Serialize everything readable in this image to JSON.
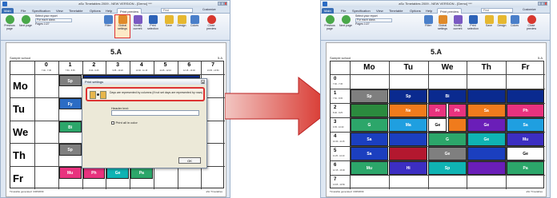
{
  "app": {
    "title": "aSc Timetables 2009 - NEW VERSION - [Demo] *** ",
    "menu_main": "Main"
  },
  "tabs": [
    "Main",
    "File",
    "Specification",
    "View",
    "Timetable",
    "Options",
    "Help",
    "Print preview"
  ],
  "find_label": "Find",
  "customize_label": "Customize",
  "ribbon": {
    "prev": "Previous page",
    "next": "Next page",
    "report_label": "Select your report",
    "report_value": "For each class",
    "pages": "Pages 1/27",
    "filter": "Filter",
    "global": "Global settings",
    "modify": "Modify current",
    "print_selection": "Print selection",
    "save": "Save",
    "design": "Design",
    "colors": "Colors",
    "close": "Close preview"
  },
  "left": {
    "school": "Sample school",
    "class": "5.A",
    "class_right": "5.A",
    "periods": [
      "0",
      "1",
      "2",
      "3",
      "4",
      "5",
      "6",
      "7"
    ],
    "period_times": [
      "7:00 - 7:45",
      "7:50 - 8:35",
      "8:40 - 9:25",
      "9:35 - 10:20",
      "10:30 - 11:15",
      "11:25 - 12:10",
      "12:15 - 13:00",
      "13:05 - 13:50"
    ],
    "days": [
      "Mo",
      "Tu",
      "We",
      "Th",
      "Fr"
    ],
    "visible_cells": [
      {
        "day": 0,
        "period": 1,
        "text": "Sp"
      },
      {
        "day": 1,
        "period": 1,
        "text": "Fy"
      },
      {
        "day": 2,
        "period": 1,
        "text": "Bi"
      },
      {
        "day": 3,
        "period": 1,
        "text": "Sp"
      },
      {
        "day": 4,
        "period": 1,
        "text": "Mu"
      },
      {
        "day": 4,
        "period": 2,
        "text": "Ph"
      },
      {
        "day": 4,
        "period": 3,
        "text": "Ge"
      },
      {
        "day": 4,
        "period": 4,
        "text": "Pa"
      }
    ],
    "footer_left": "Timetable generated: 3/28/2009",
    "footer_right": "aSc Timetables"
  },
  "dialog": {
    "title": "Print settings",
    "option_text": "Days are represented by columns (If not set days are represented by rows)",
    "header_label": "Header text:",
    "header_value": "",
    "checkbox_label": "Print all in color",
    "ok": "OK"
  },
  "right": {
    "school": "Sample school",
    "class": "5.A",
    "class_right": "5.A",
    "days": [
      "Mo",
      "Tu",
      "We",
      "Th",
      "Fr"
    ],
    "periods": [
      "0",
      "1",
      "2",
      "3",
      "4",
      "5",
      "6",
      "7"
    ],
    "period_times": [
      "7:00 - 7:45",
      "7:50 - 8:35",
      "8:40 - 9:25",
      "9:35 - 10:20",
      "10:30 - 11:15",
      "11:25 - 12:10",
      "12:15 - 13:00",
      "13:05 - 13:50"
    ],
    "cells": [
      {
        "period": 1,
        "day": 0,
        "text": "Sp",
        "color": "#7f7f7f"
      },
      {
        "period": 1,
        "day": 1,
        "text": "Sp",
        "color": "#0a2a8f"
      },
      {
        "period": 1,
        "day": 2,
        "text": "Bi",
        "color": "#0a2a8f"
      },
      {
        "period": 1,
        "day": 3,
        "text": "",
        "color": "#0a2a8f"
      },
      {
        "period": 1,
        "day": 4,
        "text": "",
        "color": "#0a2a8f"
      },
      {
        "period": 2,
        "day": 0,
        "text": "",
        "color": "#2b8a3e"
      },
      {
        "period": 2,
        "day": 1,
        "text": "Ne",
        "color": "#f07b1c"
      },
      {
        "period": 2,
        "day": 2,
        "text": "Fr",
        "color": "#e8327e"
      },
      {
        "period": 2,
        "day": 2.5,
        "text": "Ph",
        "color": "#e8327e"
      },
      {
        "period": 2,
        "day": 3,
        "text": "Sa",
        "color": "#f07b1c"
      },
      {
        "period": 2,
        "day": 4,
        "text": "Ph",
        "color": "#e8327e"
      },
      {
        "period": 3,
        "day": 0,
        "text": "G",
        "color": "#2ca66a"
      },
      {
        "period": 3,
        "day": 1,
        "text": "Ma",
        "color": "#1f9fe0"
      },
      {
        "period": 3,
        "day": 2,
        "text": "Ge",
        "color": "#ffffff"
      },
      {
        "period": 3,
        "day": 2.5,
        "text": "",
        "color": "#f07b1c"
      },
      {
        "period": 3,
        "day": 3,
        "text": "Ge",
        "color": "#6a1eb8"
      },
      {
        "period": 3,
        "day": 4,
        "text": "Sa",
        "color": "#1f9fe0"
      },
      {
        "period": 4,
        "day": 0,
        "text": "Sa",
        "color": "#1b3fbf"
      },
      {
        "period": 4,
        "day": 1,
        "text": "",
        "color": "#1b3fbf"
      },
      {
        "period": 4,
        "day": 2,
        "text": "G",
        "color": "#2ca66a"
      },
      {
        "period": 4,
        "day": 3,
        "text": "Ge",
        "color": "#0fb3b3"
      },
      {
        "period": 4,
        "day": 4,
        "text": "Mu",
        "color": "#3c2ec2"
      },
      {
        "period": 5,
        "day": 0,
        "text": "Sa",
        "color": "#1b3fbf"
      },
      {
        "period": 5,
        "day": 1,
        "text": "",
        "color": "#b3182f"
      },
      {
        "period": 5,
        "day": 2,
        "text": "Ge",
        "color": "#7f7f7f"
      },
      {
        "period": 5,
        "day": 3,
        "text": "",
        "color": "#1b3fbf"
      },
      {
        "period": 5,
        "day": 4,
        "text": "Ge",
        "color": "#ffffff"
      },
      {
        "period": 6,
        "day": 0,
        "text": "Mu",
        "color": "#2ca66a"
      },
      {
        "period": 6,
        "day": 1,
        "text": "Hi",
        "color": "#3c2ec2"
      },
      {
        "period": 6,
        "day": 2,
        "text": "Sp",
        "color": "#0fb3b3"
      },
      {
        "period": 6,
        "day": 3,
        "text": "",
        "color": "#6a1eb8"
      },
      {
        "period": 6,
        "day": 4,
        "text": "Pa",
        "color": "#2ca66a"
      }
    ],
    "footer_left": "Timetable generated: 3/28/2009",
    "footer_right": "aSc Timetables"
  },
  "colors": {
    "arrow": "#d62b23",
    "highlight": "#d33333"
  }
}
